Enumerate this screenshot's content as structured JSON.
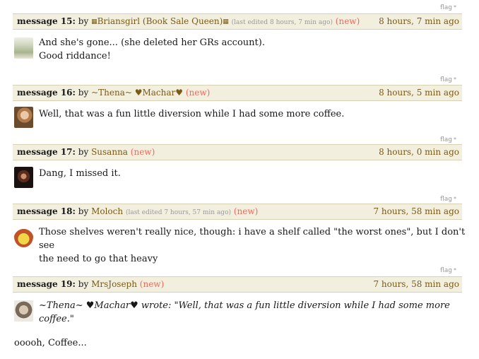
{
  "flag_label": "flag",
  "flag_star": "*",
  "messages": [
    {
      "label": "message 15:",
      "by": "by",
      "user": "Briansgirl (Book Sale Queen)",
      "edited": "(last edited 8 hours, 7 min ago)",
      "new": "(new)",
      "time": "8 hours, 7 min ago",
      "line1": "And she's gone... (she deleted her GRs account).",
      "line2": "Good riddance!"
    },
    {
      "label": "message 16:",
      "by": "by",
      "user": "~Thena~ ♥Machar♥",
      "new": "(new)",
      "time": "8 hours, 5 min ago",
      "line1": "Well, that was a fun little diversion while I had some more coffee."
    },
    {
      "label": "message 17:",
      "by": "by",
      "user": "Susanna",
      "new": "(new)",
      "time": "8 hours, 0 min ago",
      "line1": "Dang, I missed it."
    },
    {
      "label": "message 18:",
      "by": "by",
      "user": "Moloch",
      "edited": "(last edited 7 hours, 57 min ago)",
      "new": "(new)",
      "time": "7 hours, 58 min ago",
      "line1": "Those shelves weren't really nice, though: i have a shelf called \"the worst ones\", but I don't see",
      "line2": "the need to go that heavy"
    },
    {
      "label": "message 19:",
      "by": "by",
      "user": "MrsJoseph",
      "new": "(new)",
      "time": "7 hours, 58 min ago",
      "line1": "~Thena~ ♥Machar♥ wrote: \"Well, that was a fun little diversion while I had some more",
      "line2": "coffee.\"",
      "reply": "ooooh, Coffee..."
    }
  ],
  "icons": {
    "book_badge": "book-badge-icon",
    "avatar": "user-avatar-image"
  },
  "colors": {
    "header_bg": "#f2efdf",
    "link": "#7b5a13",
    "new": "#ef6a5a",
    "meta": "#999999"
  }
}
